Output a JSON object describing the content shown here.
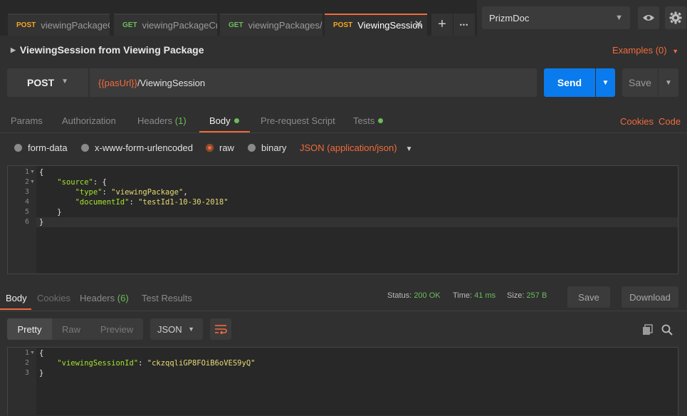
{
  "tabs": [
    {
      "method": "POST",
      "title": "viewingPackageCrea"
    },
    {
      "method": "GET",
      "title": "viewingPackageCreate"
    },
    {
      "method": "GET",
      "title": "viewingPackages/{do"
    },
    {
      "method": "POST",
      "title": "ViewingSession",
      "active": true
    }
  ],
  "tab_actions": {
    "add": "+",
    "more": "•••",
    "close": "✕"
  },
  "environment": {
    "selected": "PrizmDoc"
  },
  "request": {
    "title": "ViewingSession from Viewing Package",
    "examples": "Examples (0)",
    "method": "POST",
    "url_var": "{{pasUrl}}",
    "url_path": "/ViewingSession",
    "send": "Send",
    "save": "Save"
  },
  "request_tabs": {
    "params": "Params",
    "authorization": "Authorization",
    "headers": "Headers",
    "headers_count": "(1)",
    "body": "Body",
    "prerequest": "Pre-request Script",
    "tests": "Tests",
    "cookies": "Cookies",
    "code": "Code"
  },
  "body_types": {
    "form_data": "form-data",
    "urlencoded": "x-www-form-urlencoded",
    "raw": "raw",
    "binary": "binary",
    "content_type": "JSON (application/json)"
  },
  "request_body": {
    "line_numbers": [
      "1",
      "2",
      "3",
      "4",
      "5",
      "6"
    ],
    "l1": "{",
    "l2_key": "\"source\"",
    "l2_rest": ": {",
    "l3_key": "\"type\"",
    "l3_val": "\"viewingPackage\"",
    "l4_key": "\"documentId\"",
    "l4_val": "\"testId1-10-30-2018\"",
    "l5": "}",
    "l6": "}"
  },
  "response_tabs": {
    "body": "Body",
    "cookies": "Cookies",
    "headers": "Headers",
    "headers_count": "(6)",
    "test_results": "Test Results"
  },
  "response_status": {
    "status_label": "Status:",
    "status": "200 OK",
    "time_label": "Time:",
    "time": "41 ms",
    "size_label": "Size:",
    "size": "257 B",
    "save": "Save",
    "download": "Download"
  },
  "response_format": {
    "pretty": "Pretty",
    "raw": "Raw",
    "preview": "Preview",
    "format": "JSON"
  },
  "response_body": {
    "line_numbers": [
      "1",
      "2",
      "3"
    ],
    "l1": "{",
    "l2_key": "\"viewingSessionId\"",
    "l2_val": "\"ckzqqliGP8FOiB6oVES9yQ\"",
    "l3": "}"
  },
  "colors": {
    "accent": "#f26b3a",
    "send": "#097bed",
    "success": "#6bbd5b",
    "post": "#f5a623"
  }
}
